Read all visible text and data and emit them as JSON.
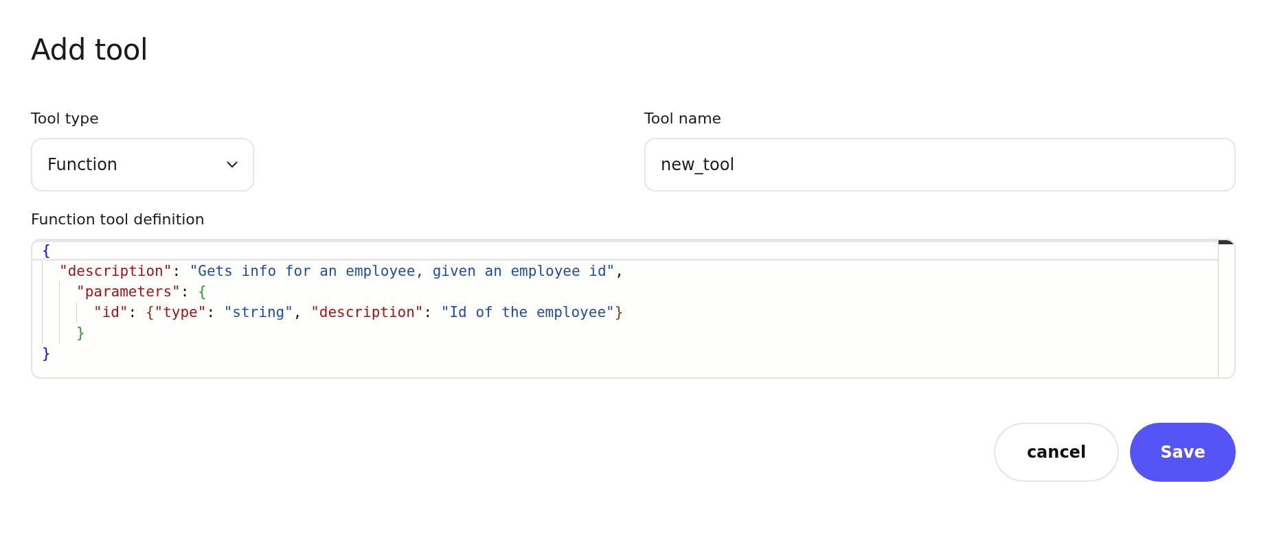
{
  "title": "Add tool",
  "tool_type": {
    "label": "Tool type",
    "value": "Function"
  },
  "tool_name": {
    "label": "Tool name",
    "value": "new_tool"
  },
  "definition": {
    "label": "Function tool definition",
    "lines": [
      {
        "current": true,
        "tokens": [
          {
            "kind": "brace1",
            "text": "{"
          }
        ]
      },
      {
        "current": false,
        "tokens": [
          {
            "kind": "key",
            "text": "  \"description\""
          },
          {
            "kind": "punct",
            "text": ": "
          },
          {
            "kind": "string",
            "text": "\"Gets info for an employee, given an employee id\""
          },
          {
            "kind": "punct",
            "text": ","
          }
        ]
      },
      {
        "current": false,
        "tokens": [
          {
            "kind": "key",
            "text": "    \"parameters\""
          },
          {
            "kind": "punct",
            "text": ": "
          },
          {
            "kind": "brace2",
            "text": "{"
          }
        ]
      },
      {
        "current": false,
        "tokens": [
          {
            "kind": "key",
            "text": "      \"id\""
          },
          {
            "kind": "punct",
            "text": ": "
          },
          {
            "kind": "brace3",
            "text": "{"
          },
          {
            "kind": "key",
            "text": "\"type\""
          },
          {
            "kind": "punct",
            "text": ": "
          },
          {
            "kind": "string",
            "text": "\"string\""
          },
          {
            "kind": "punct",
            "text": ", "
          },
          {
            "kind": "key",
            "text": "\"description\""
          },
          {
            "kind": "punct",
            "text": ": "
          },
          {
            "kind": "string",
            "text": "\"Id of the employee\""
          },
          {
            "kind": "brace3",
            "text": "}"
          }
        ]
      },
      {
        "current": false,
        "tokens": [
          {
            "kind": "brace2",
            "text": "    }"
          }
        ]
      },
      {
        "current": false,
        "tokens": [
          {
            "kind": "brace1",
            "text": "}"
          }
        ]
      }
    ]
  },
  "buttons": [
    {
      "kind": "secondary",
      "label": "cancel"
    },
    {
      "kind": "primary",
      "label": "Save"
    }
  ]
}
